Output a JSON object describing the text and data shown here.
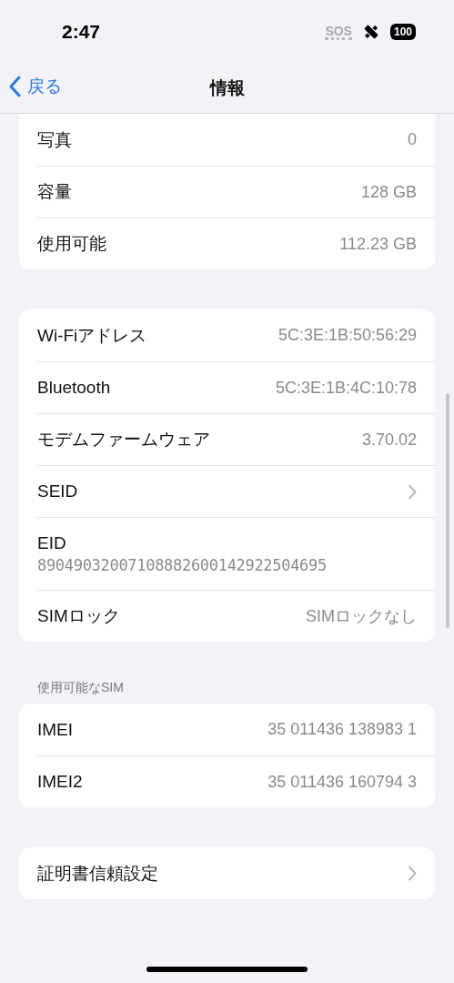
{
  "status_bar": {
    "time": "2:47",
    "sos": "SOS",
    "battery": "100"
  },
  "nav": {
    "back": "戻る",
    "title": "情報"
  },
  "sections": [
    {
      "rows": [
        {
          "kind": "value",
          "label": "写真",
          "value": "0"
        },
        {
          "kind": "value",
          "label": "容量",
          "value": "128 GB"
        },
        {
          "kind": "value",
          "label": "使用可能",
          "value": "112.23 GB"
        }
      ]
    },
    {
      "rows": [
        {
          "kind": "value",
          "label": "Wi-Fiアドレス",
          "value": "5C:3E:1B:50:56:29"
        },
        {
          "kind": "value",
          "label": "Bluetooth",
          "value": "5C:3E:1B:4C:10:78"
        },
        {
          "kind": "value",
          "label": "モデムファームウェア",
          "value": "3.70.02"
        },
        {
          "kind": "link",
          "label": "SEID"
        },
        {
          "kind": "stacked",
          "label": "EID",
          "value": "89049032007108882600142922504695"
        },
        {
          "kind": "value",
          "label": "SIMロック",
          "value": "SIMロックなし"
        }
      ]
    },
    {
      "header": "使用可能なSIM",
      "rows": [
        {
          "kind": "value",
          "label": "IMEI",
          "value": "35 011436 138983 1"
        },
        {
          "kind": "value",
          "label": "IMEI2",
          "value": "35 011436 160794 3"
        }
      ]
    },
    {
      "rows": [
        {
          "kind": "link",
          "label": "証明書信頼設定"
        }
      ]
    }
  ]
}
